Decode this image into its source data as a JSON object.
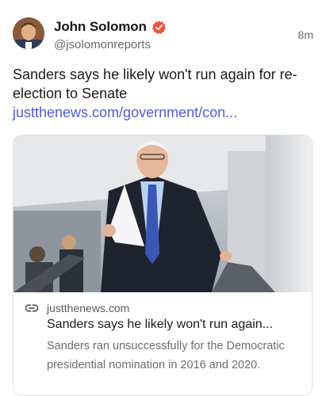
{
  "author": {
    "display_name": "John Solomon",
    "handle": "@jsolomonreports",
    "verified_icon": "verified-badge-icon",
    "avatar_icon": "avatar"
  },
  "timestamp": "8m",
  "post": {
    "text": "Sanders says he likely won't run again for re-election to Senate ",
    "link_text": "justthenews.com/government/con..."
  },
  "link_card": {
    "domain": "justthenews.com",
    "title": "Sanders says he likely won't run again...",
    "description": "Sanders ran unsuccessfully for the Democratic presidential nomination in 2016 and 2020."
  },
  "colors": {
    "link": "#4f5cd6",
    "verified_badge": "#e8563f",
    "muted_text": "#6a6a6a"
  }
}
